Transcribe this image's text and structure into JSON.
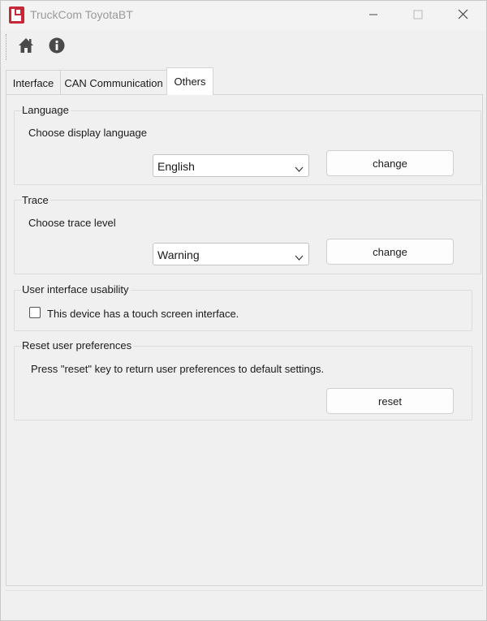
{
  "window": {
    "title": "TruckCom ToyotaBT",
    "icon": "truckcom-app-icon",
    "controls": {
      "minimize": "minimize-icon",
      "maximize": "maximize-icon",
      "close": "close-icon"
    }
  },
  "toolbar": {
    "items": [
      {
        "name": "home",
        "icon": "home-icon"
      },
      {
        "name": "info",
        "icon": "info-icon"
      }
    ]
  },
  "tabs": {
    "interface": "Interface",
    "can": "CAN Communication",
    "others": "Others",
    "active": "Others"
  },
  "language": {
    "title": "Language",
    "description": "Choose display language",
    "selected": "English",
    "button": "change"
  },
  "trace": {
    "title": "Trace",
    "description": "Choose trace level",
    "selected": "Warning",
    "button": "change"
  },
  "usability": {
    "title": "User interface usability",
    "checkbox_label": "This device has a touch screen interface.",
    "checked": false
  },
  "reset": {
    "title": "Reset user preferences",
    "description": "Press \"reset\" key to return user preferences to default settings.",
    "button": "reset"
  },
  "colors": {
    "app_icon_red": "#c6283a",
    "window_bg": "#f0f0f0",
    "active_tab_bg": "#ffffff"
  }
}
